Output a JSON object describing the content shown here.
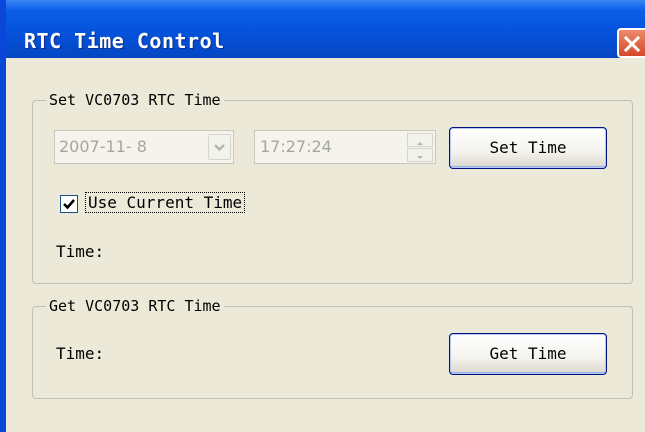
{
  "window": {
    "title": "RTC Time Control"
  },
  "set_group": {
    "legend": "Set VC0703 RTC Time",
    "date_value": "2007-11- 8",
    "time_value": "17:27:24",
    "set_button": "Set Time",
    "use_current_label": "Use Current Time",
    "use_current_checked": true,
    "time_label": "Time:"
  },
  "get_group": {
    "legend": "Get VC0703 RTC Time",
    "time_label": "Time:",
    "get_button": "Get Time"
  },
  "colors": {
    "titlebar": "#0552dc",
    "close_button": "#d6472a",
    "dialog_bg": "#ece9d8",
    "disabled_text": "#a7a69c",
    "button_border": "#00137f"
  }
}
